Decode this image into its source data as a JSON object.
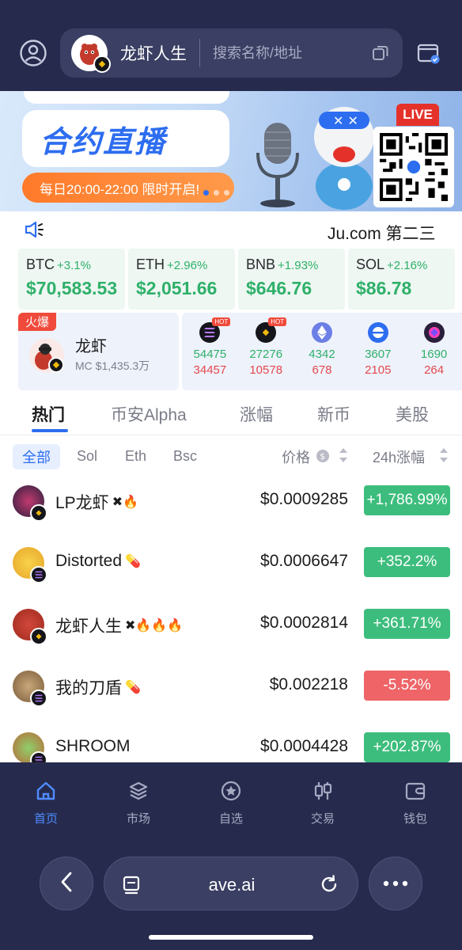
{
  "header": {
    "token_name": "龙虾人生",
    "search_placeholder": "搜索名称/地址"
  },
  "banner": {
    "title": "合约直播",
    "subtitle": "每日20:00-22:00 限时开启!",
    "live_label": "LIVE"
  },
  "announcement": {
    "text": "Ju.com 第二三"
  },
  "prices": [
    {
      "symbol": "BTC",
      "change": "+3.1%",
      "price": "$70,583.53"
    },
    {
      "symbol": "ETH",
      "change": "+2.96%",
      "price": "$2,051.66"
    },
    {
      "symbol": "BNB",
      "change": "+1.93%",
      "price": "$646.76"
    },
    {
      "symbol": "SOL",
      "change": "+2.16%",
      "price": "$86.78"
    }
  ],
  "featured": {
    "tag": "火爆",
    "name": "龙虾",
    "mc": "MC $1,435.3万"
  },
  "chains": [
    {
      "icon": "solana-icon",
      "hot": "HOT",
      "up": "54475",
      "down": "34457",
      "color": "#15161c"
    },
    {
      "icon": "bnb-icon",
      "hot": "HOT",
      "up": "27276",
      "down": "10578",
      "color": "#15161c"
    },
    {
      "icon": "ethereum-icon",
      "hot": "",
      "up": "4342",
      "down": "678",
      "color": "#6c7fe6"
    },
    {
      "icon": "base-icon",
      "hot": "",
      "up": "3607",
      "down": "2105",
      "color": "#2d6df0"
    },
    {
      "icon": "monad-icon",
      "hot": "",
      "up": "1690",
      "down": "264",
      "color": "#2a1f3d"
    }
  ],
  "tabs": [
    "热门",
    "币安Alpha",
    "涨幅",
    "新币",
    "美股"
  ],
  "filters": [
    "全部",
    "Sol",
    "Eth",
    "Bsc"
  ],
  "sort": {
    "price": "价格",
    "change": "24h涨幅"
  },
  "tokens": [
    {
      "name": "LP龙虾",
      "badges": "✖🔥",
      "price": "$0.0009285",
      "change": "+1,786.99%",
      "dir": "up",
      "chain": "bnb"
    },
    {
      "name": "Distorted",
      "badges": "💊",
      "price": "$0.0006647",
      "change": "+352.2%",
      "dir": "up",
      "chain": "sol"
    },
    {
      "name": "龙虾人生",
      "badges": "✖🔥🔥🔥",
      "price": "$0.0002814",
      "change": "+361.71%",
      "dir": "up",
      "chain": "bnb"
    },
    {
      "name": "我的刀盾",
      "badges": "💊",
      "price": "$0.002218",
      "change": "-5.52%",
      "dir": "down",
      "chain": "sol"
    },
    {
      "name": "SHROOM",
      "badges": "",
      "price": "$0.0004428",
      "change": "+202.87%",
      "dir": "up",
      "chain": "sol"
    }
  ],
  "nav": [
    "首页",
    "市场",
    "自选",
    "交易",
    "钱包"
  ],
  "browser": {
    "url": "ave.ai"
  },
  "colors": {
    "header_bg": "#262b4e",
    "accent": "#2d6df0",
    "up": "#3dbd7d",
    "down": "#ee6467"
  }
}
